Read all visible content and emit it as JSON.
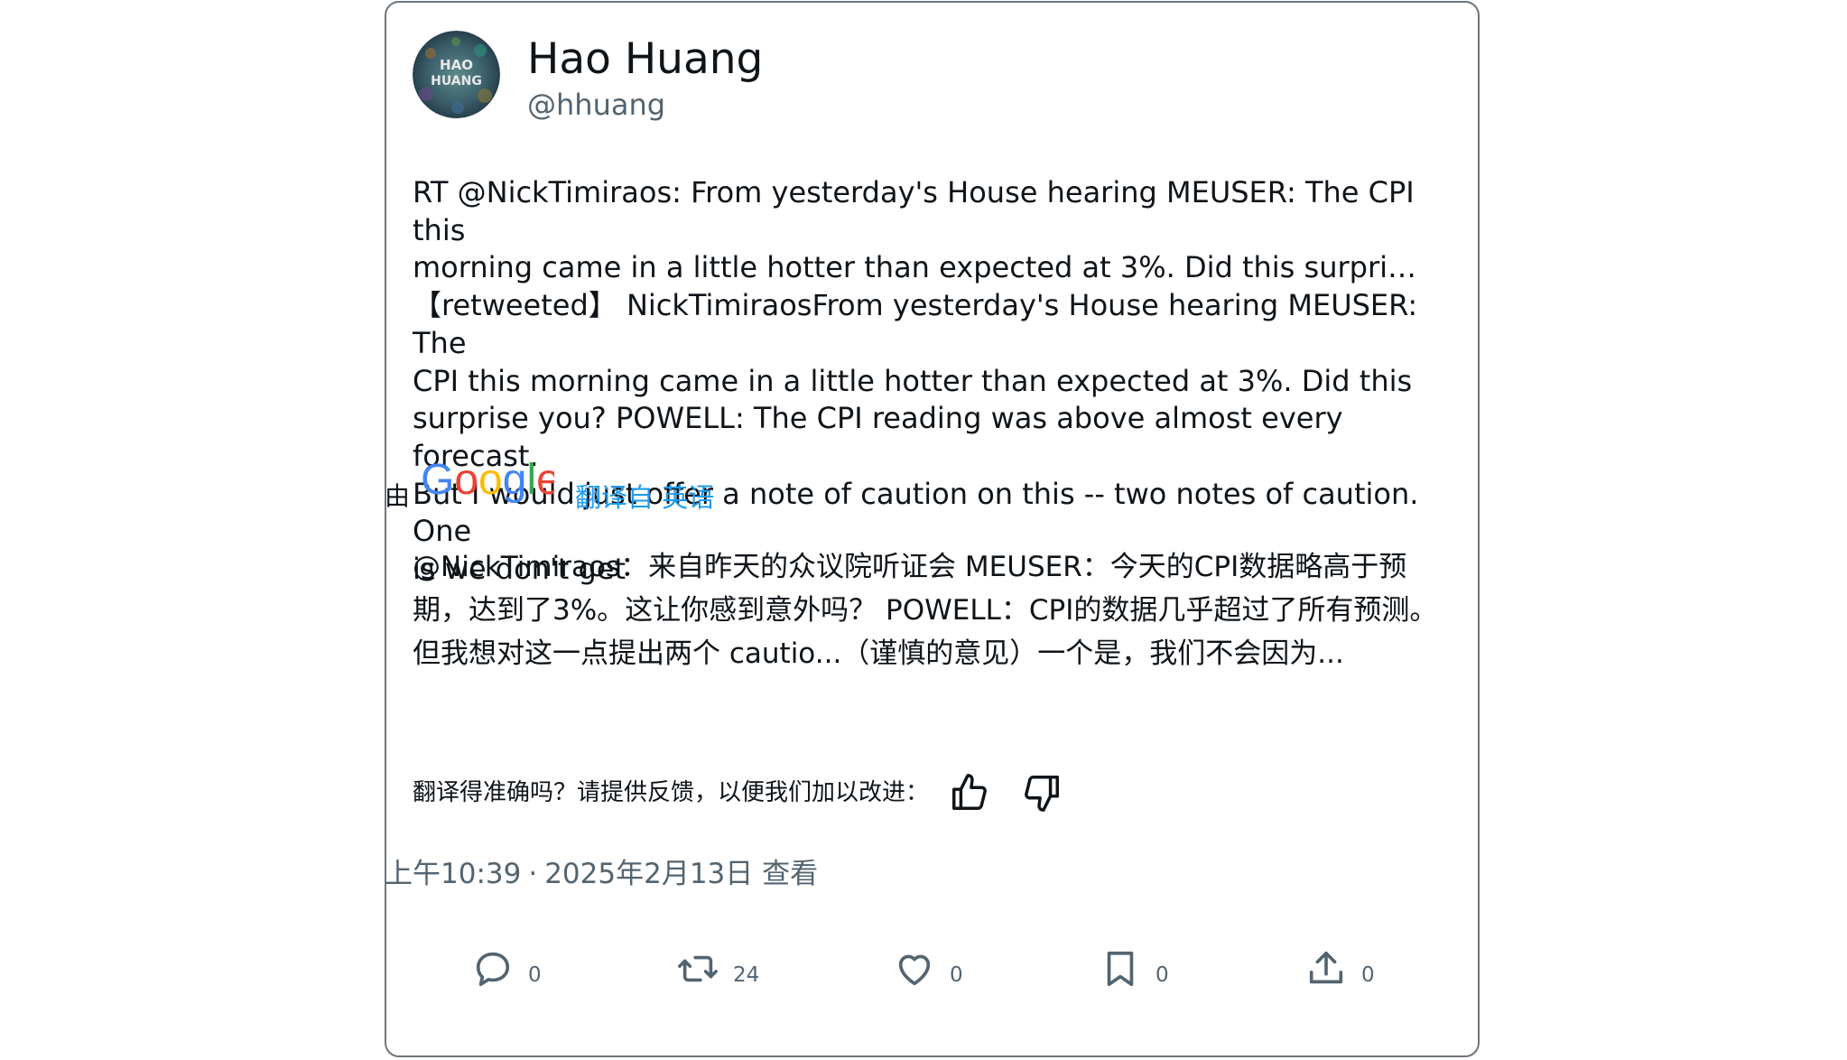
{
  "author": {
    "name": "Hao Huang",
    "handle": "@hhuang",
    "avatar_text_line1": "HAO",
    "avatar_text_line2": "HUANG"
  },
  "tweet": {
    "text": "RT @NickTimiraos: From yesterday's House hearing MEUSER: The CPI this\nmorning came in a little hotter than expected at 3%. Did this surpri…\n【retweeted】 NickTimiraosFrom yesterday's House hearing MEUSER: The\nCPI this morning came in a little hotter than expected at 3%. Did this\nsurprise you? POWELL: The CPI reading was above almost every forecast.\nBut I would just offer a note of caution on this -- two notes of caution. One\nis we don't get"
  },
  "translation_bar": {
    "by_label": "由",
    "google_logo_text": "Google",
    "translated_from": "翻译自 英语"
  },
  "translation": {
    "text": "@NickTimiraos：来自昨天的众议院听证会 MEUSER：今天的CPI数据略高于预期，达到了3%。这让你感到意外吗？ POWELL：CPI的数据几乎超过了所有预测。但我想对这一点提出两个 cautio...（谨慎的意见）一个是，我们不会因为..."
  },
  "feedback": {
    "prompt": "翻译得准确吗？请提供反馈，以便我们加以改进："
  },
  "meta": {
    "time": "上午10:39",
    "separator": "·",
    "date": "2025年2月13日",
    "view_label": "查看"
  },
  "actions": {
    "reply_count": "0",
    "retweet_count": "24",
    "like_count": "0",
    "bookmark_count": "0",
    "share_count": "0"
  },
  "colors": {
    "link": "#1d9bf0",
    "secondary_text": "#536471",
    "border": "#6e767d"
  },
  "icons": [
    "reply-icon",
    "retweet-icon",
    "like-icon",
    "bookmark-icon",
    "share-icon",
    "thumbs-up-icon",
    "thumbs-down-icon"
  ]
}
